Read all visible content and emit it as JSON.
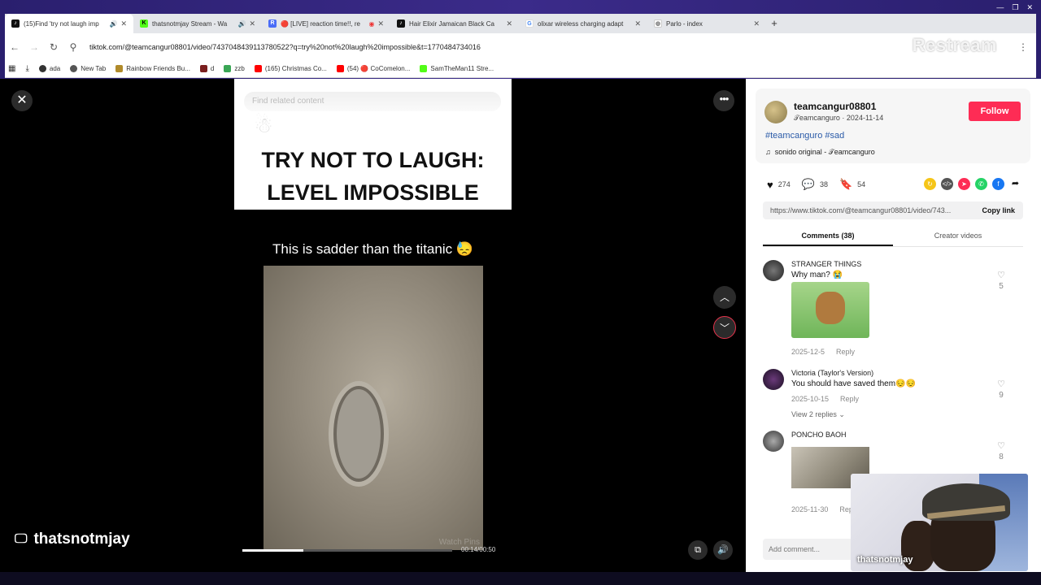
{
  "browser": {
    "tabs": [
      {
        "title": "(15)Find 'try not laugh imp",
        "icon_color": "#111111",
        "audio": true,
        "active": true
      },
      {
        "title": "thatsnotmjay Stream - Wa",
        "icon_color": "#53fc18",
        "audio": true,
        "active": false
      },
      {
        "title": "🔴 [LIVE] reaction time!!, re",
        "icon_color": "#4a6cf7",
        "audio": false,
        "active": false
      },
      {
        "title": "Hair Elixir Jamaican Black Ca",
        "icon_color": "#111111",
        "audio": false,
        "active": false
      },
      {
        "title": "olixar wireless charging adapt",
        "icon_color": "#4285f4",
        "audio": false,
        "active": false
      },
      {
        "title": "Parlo - index",
        "icon_color": "#777777",
        "audio": false,
        "active": false
      }
    ],
    "url": "tiktok.com/@teamcangur08801/video/7437048439113780522?q=try%20not%20laugh%20impossible&t=1770484734016",
    "overlay_brand": "Restream",
    "bookmarks": [
      {
        "label": "ada",
        "color": "#333333"
      },
      {
        "label": "New Tab",
        "color": "#555555"
      },
      {
        "label": "Rainbow Friends Bu...",
        "color": "#b08a2a"
      },
      {
        "label": "d",
        "color": "#7a1f1f"
      },
      {
        "label": "zzb",
        "color": "#3aa655"
      },
      {
        "label": "(165) Christmas Co...",
        "color": "#ff0000"
      },
      {
        "label": "(54) 🔴 CoComelon...",
        "color": "#ff0000"
      },
      {
        "label": "SamTheMan11 Stre...",
        "color": "#53fc18"
      }
    ]
  },
  "video": {
    "search_placeholder": "Find related content",
    "title_line1": "TRY NOT TO LAUGH:",
    "title_line2": "LEVEL IMPOSSIBLE",
    "caption": "This is sadder than the titanic 😓",
    "watermark": "Watch Pins",
    "time": "00:14/00:50",
    "progress_fraction": 0.29,
    "streamer_name": "thatsnotmjay"
  },
  "panel": {
    "username": "teamcangur08801",
    "subline": "𝒯eamcanguro · 2024-11-14",
    "follow_label": "Follow",
    "hashtags": "#teamcanguro #sad",
    "sound": "sonido original - 𝒯eamcanguro",
    "likes": "274",
    "comments_count": "38",
    "saves": "54",
    "link": "https://www.tiktok.com/@teamcangur08801/video/743...",
    "copy_label": "Copy link",
    "tab_comments": "Comments (38)",
    "tab_creator": "Creator videos",
    "comments": [
      {
        "name": "STRANGER THINGS",
        "text": "Why man? 😭",
        "date": "2025-12-5",
        "reply": "Reply",
        "likes": "5"
      },
      {
        "name": "Victoria (Taylor's Version)",
        "text": "You should have saved them😔😔",
        "date": "2025-10-15",
        "reply": "Reply",
        "likes": "9",
        "view_replies": "View 2 replies ⌄"
      },
      {
        "name": "PONCHO BAOH",
        "text": "",
        "date": "2025-11-30",
        "reply": "Reply",
        "likes": "8"
      }
    ],
    "add_comment_placeholder": "Add comment..."
  },
  "webcam": {
    "label": "thatsnotmjay"
  }
}
